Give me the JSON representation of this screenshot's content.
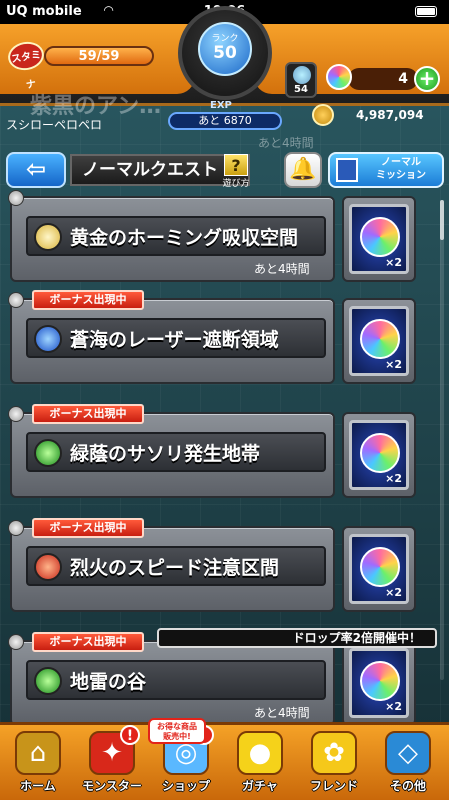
{
  "status_bar": {
    "carrier": "UQ mobile",
    "time": "19:06"
  },
  "hud": {
    "stamina_label": "スタミナ",
    "stamina_value": "59/59",
    "stamina_fraction": 1.0,
    "rank_label": "ランク",
    "rank_value": "50",
    "exp_label": "EXP",
    "exp_remaining": "あと 6870",
    "gem_count": "54",
    "orb_count": "4",
    "add_orbs_label": "+"
  },
  "user": {
    "username": "スシローペロペロ",
    "coins": "4,987,094",
    "faded_quest_text": "紫黒のアン…",
    "faded_time": "あと4時間"
  },
  "titlebar": {
    "back_label": "⇦",
    "title": "ノーマルクエスト",
    "help_symbol": "?",
    "help_label": "遊び方",
    "mission_label": "ノーマル\nミッション"
  },
  "quests": [
    {
      "name": "黄金のホーミング吸収空間",
      "element": "light",
      "bonus": "",
      "remaining": "あと4時間",
      "reward_multiplier": "×2"
    },
    {
      "name": "蒼海のレーザー遮断領域",
      "element": "water",
      "bonus": "ボーナス出現中",
      "remaining": "",
      "reward_multiplier": "×2"
    },
    {
      "name": "緑蔭のサソリ発生地帯",
      "element": "wood",
      "bonus": "ボーナス出現中",
      "remaining": "",
      "reward_multiplier": "×2"
    },
    {
      "name": "烈火のスピード注意区間",
      "element": "fire",
      "bonus": "ボーナス出現中",
      "remaining": "",
      "reward_multiplier": "×2"
    },
    {
      "name": "地雷の谷",
      "element": "wood",
      "bonus": "ボーナス出現中",
      "remaining": "あと4時間",
      "reward_multiplier": "×2"
    }
  ],
  "drop_banner": "ドロップ率2倍開催中！",
  "bottom_nav": {
    "sale_tag": "お得な商品\n販売中!",
    "items": [
      {
        "label": "ホーム",
        "icon": "home-icon"
      },
      {
        "label": "モンスター",
        "icon": "monster-icon",
        "alert": "!"
      },
      {
        "label": "ショップ",
        "icon": "shop-icon",
        "alert": "!"
      },
      {
        "label": "ガチャ",
        "icon": "gacha-icon"
      },
      {
        "label": "フレンド",
        "icon": "friend-icon"
      },
      {
        "label": "その他",
        "icon": "other-icon"
      }
    ]
  },
  "colors": {
    "hud_orange": "#f6a12a",
    "bonus_red": "#c81e10",
    "panel_gray": "#8c9198"
  }
}
